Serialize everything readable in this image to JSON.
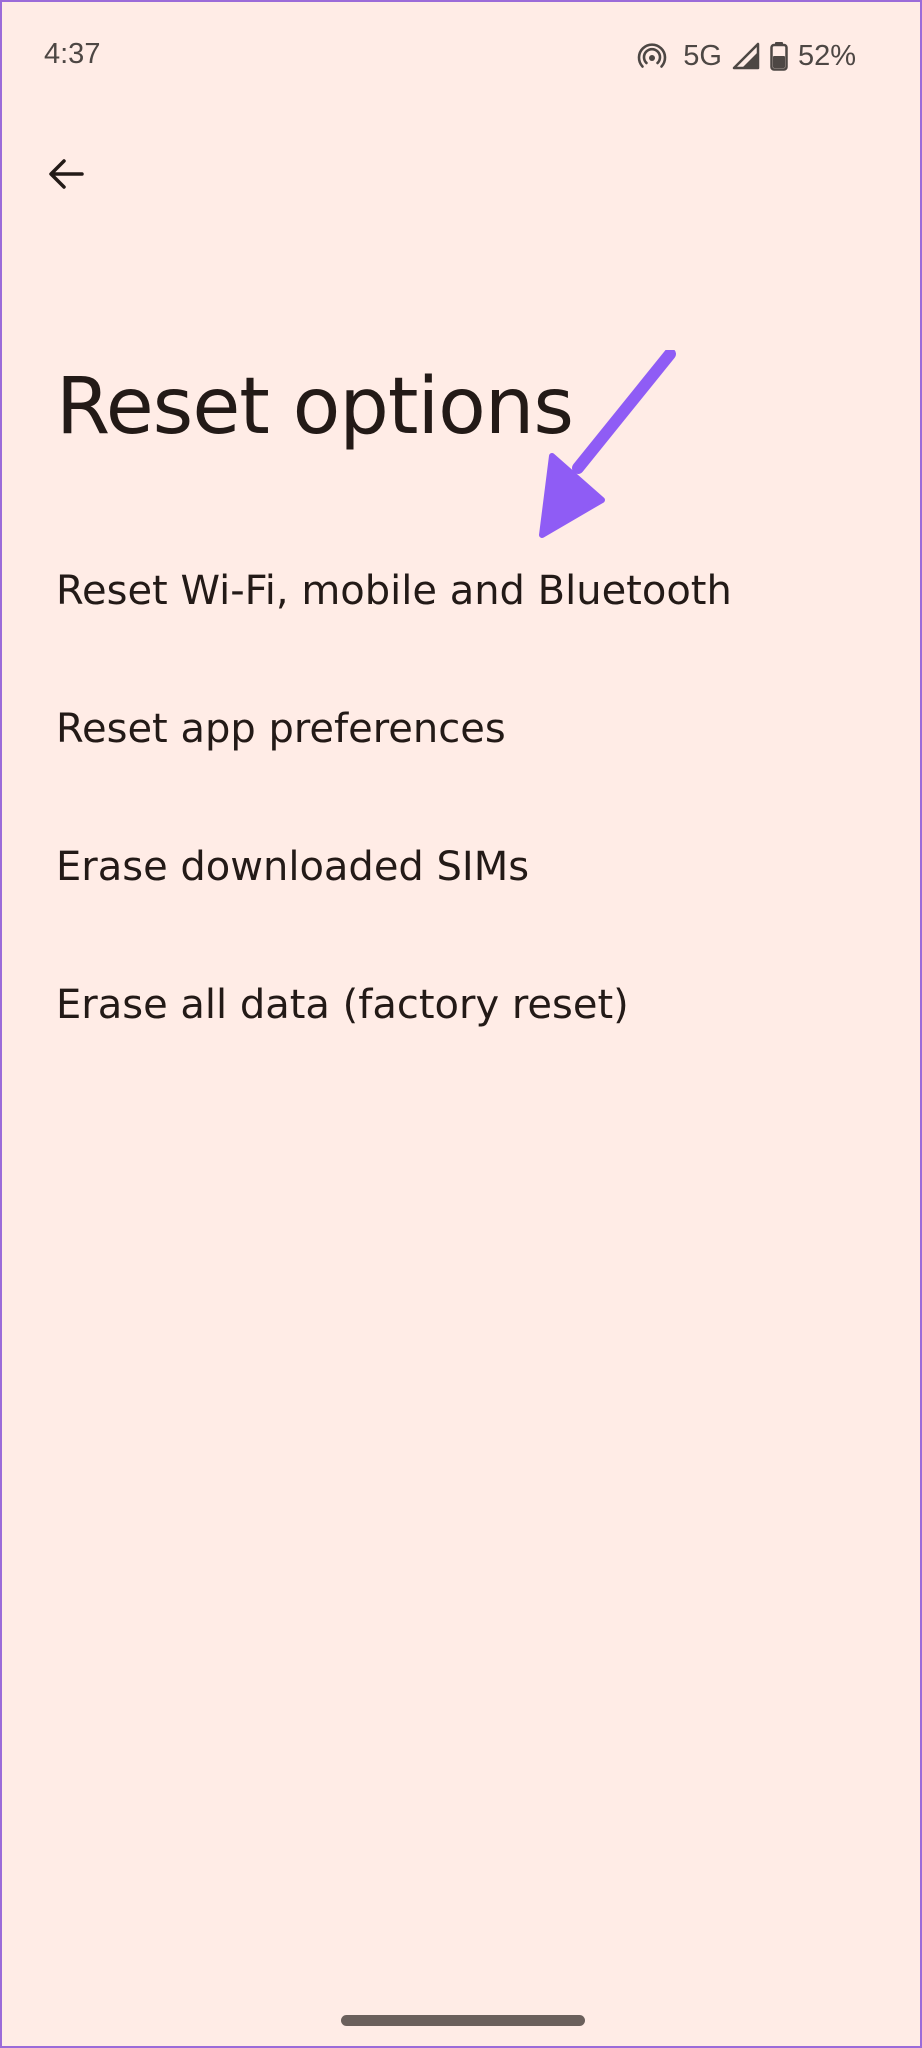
{
  "status_bar": {
    "time": "4:37",
    "network": "5G",
    "battery": "52%",
    "icons": [
      "hotspot-icon",
      "signal-icon",
      "battery-icon"
    ]
  },
  "header": {
    "back_icon": "arrow-left-icon",
    "title": "Reset options"
  },
  "options": [
    {
      "label": "Reset Wi-Fi, mobile and Bluetooth"
    },
    {
      "label": "Reset app preferences"
    },
    {
      "label": "Erase downloaded SIMs"
    },
    {
      "label": "Erase all data (factory reset)"
    }
  ],
  "annotation": {
    "color": "#8f5cf5",
    "points_to": "Reset Wi-Fi, mobile and Bluetooth"
  },
  "colors": {
    "background": "#ffece6",
    "text": "#231a17",
    "status_text": "#4d4744"
  }
}
